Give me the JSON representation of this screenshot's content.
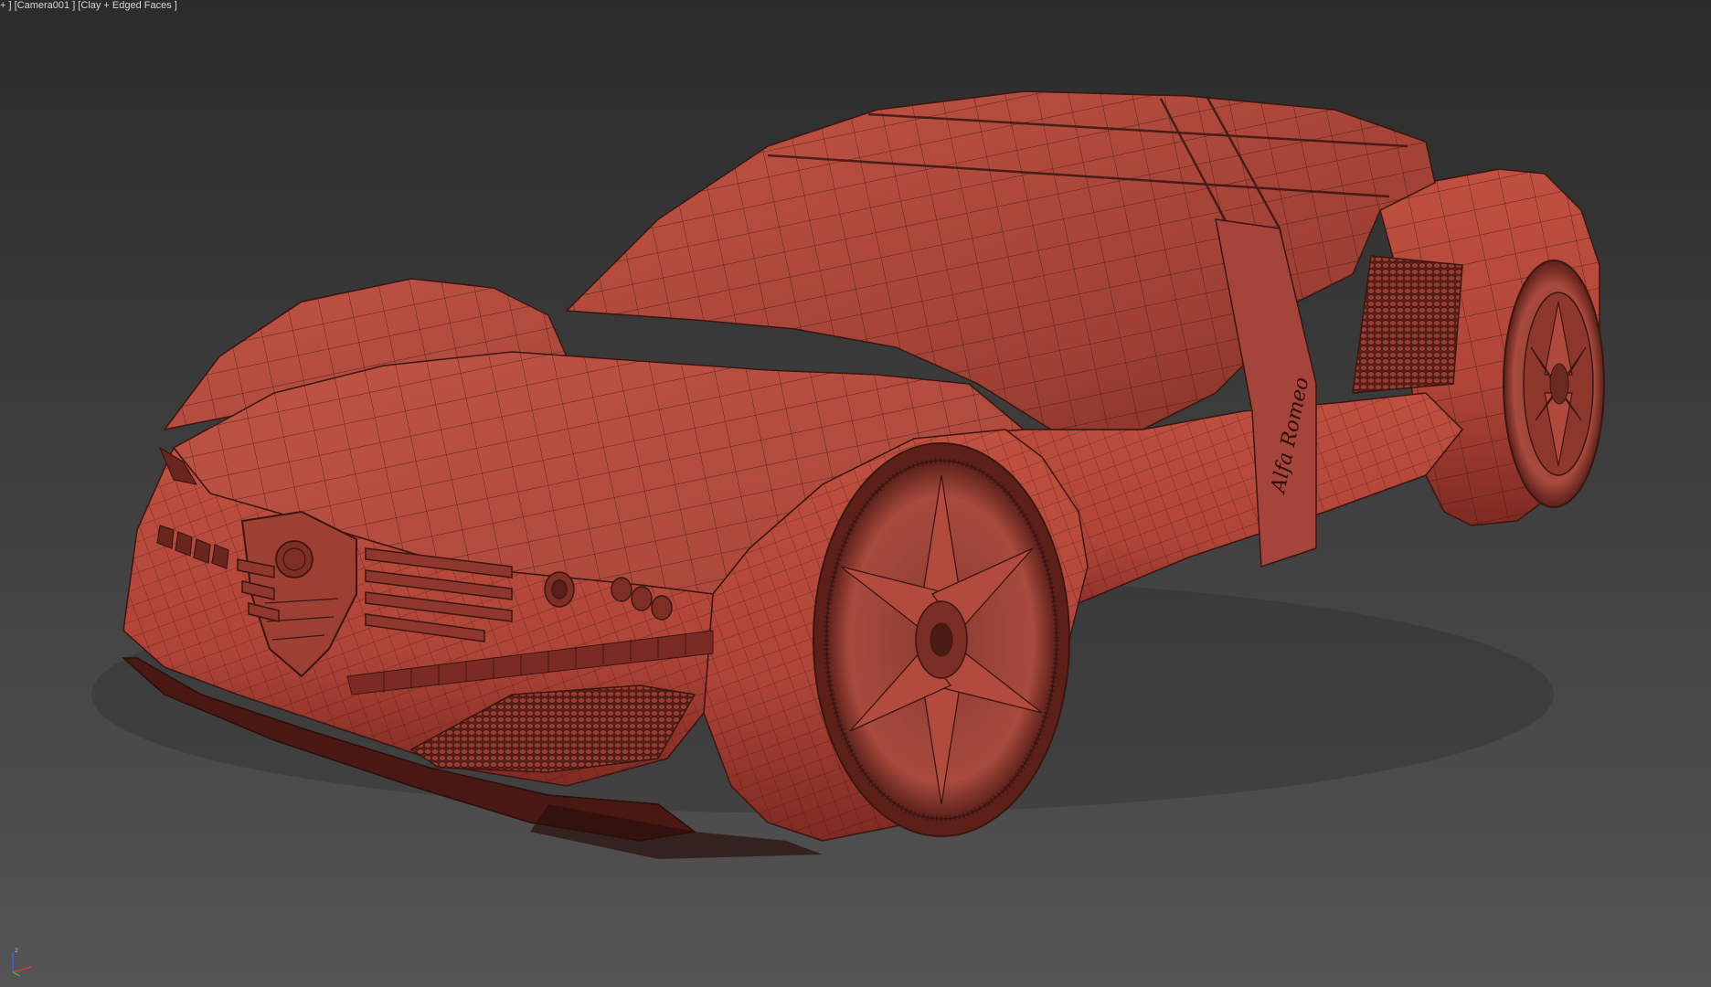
{
  "viewport": {
    "label_parts": {
      "menu_plus": "+ ] [",
      "camera": "Camera001",
      "sep": " ] [",
      "shading": "Clay + Edged Faces",
      "end": " ]"
    },
    "background_top": "#2b2b2b",
    "background_bottom": "#545454"
  },
  "scene": {
    "object": "car-model",
    "body_color": "#b5473c",
    "wire_color": "#3a1612",
    "emblem_text": "Alfa Romeo"
  },
  "axis_tripod": {
    "z_label": "z",
    "x_color": "#d04030",
    "y_color": "#40b040",
    "z_color": "#4060e0"
  }
}
